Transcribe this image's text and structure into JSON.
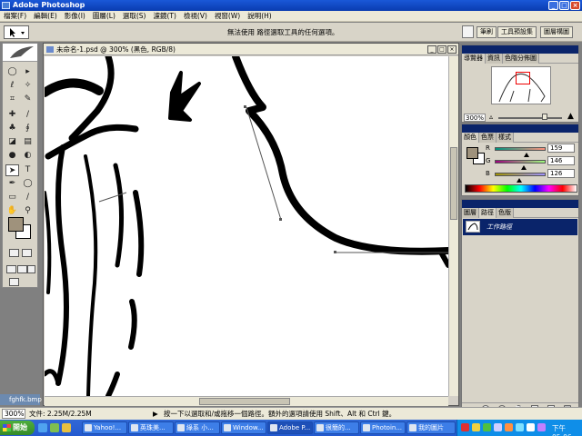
{
  "window": {
    "title": "Adobe Photoshop"
  },
  "menubar": {
    "items": [
      "檔案(F)",
      "編輯(E)",
      "影像(I)",
      "圖層(L)",
      "選取(S)",
      "濾鏡(T)",
      "檢視(V)",
      "視窗(W)",
      "說明(H)"
    ]
  },
  "options": {
    "hint": "無法使用 路徑選取工具的任何選項。"
  },
  "palette_well": {
    "tabs": [
      "筆刷",
      "工具預設集",
      "圖層構圖"
    ]
  },
  "document": {
    "title": "未命名-1.psd @ 300% (黑色, RGB/8)"
  },
  "navigator": {
    "tabs": [
      "導覽器",
      "資訊",
      "色階分佈圖"
    ],
    "zoom": "300%"
  },
  "color_palette": {
    "tabs": [
      "顏色",
      "色票",
      "樣式"
    ],
    "channels": [
      {
        "label": "R",
        "value": "159",
        "fraction": 0.62
      },
      {
        "label": "G",
        "value": "146",
        "fraction": 0.57
      },
      {
        "label": "B",
        "value": "126",
        "fraction": 0.49
      }
    ]
  },
  "paths_palette": {
    "tabs": [
      "圖層",
      "路徑",
      "色版"
    ],
    "items": [
      {
        "name": "工作路徑"
      }
    ]
  },
  "layer_caption": "fghfk.bmp",
  "status": {
    "zoom": "300%",
    "doc_size": "文件: 2.25M/2.25M",
    "hint": "按一下以選取和/或拖移一個路徑。額外的選項請使用 Shift、Alt 和 Ctrl 鍵。"
  },
  "taskbar": {
    "start_label": "開始",
    "tasks": [
      "Yahoo!...",
      "英珠美...",
      "綠系 小...",
      "Window...",
      "Adobe P...",
      "很簡的...",
      "Photoin...",
      "我的圖片"
    ],
    "clock": "下午 05:06"
  },
  "colors": {
    "foreground": "#9f927c",
    "background": "#ffffff",
    "selection": "#0a246a"
  }
}
